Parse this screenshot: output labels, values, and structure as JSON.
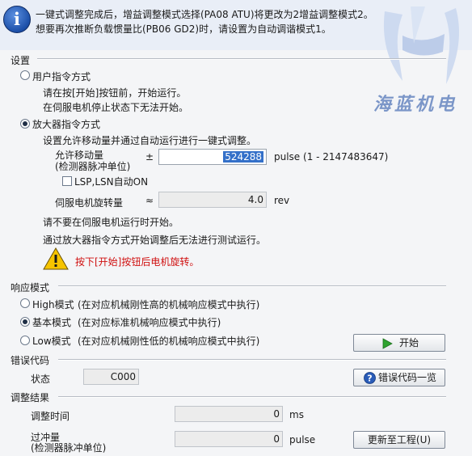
{
  "message": {
    "line1": "一键式调整完成后，增益调整模式选择(PA08 ATU)将更改为2增益调整模式2。",
    "line2": "想要再次推断负载惯量比(PB06 GD2)时，请设置为自动调谐模式1。"
  },
  "watermark": {
    "text": "海蓝机电"
  },
  "settings": {
    "title": "设置",
    "user_cmd": {
      "label": "用户指令方式",
      "checked": false,
      "desc1": "请在按[开始]按钮前，开始运行。",
      "desc2": "在伺服电机停止状态下无法开始。"
    },
    "amp_cmd": {
      "label": "放大器指令方式",
      "checked": true,
      "desc": "设置允许移动量并通过自动运行进行一键式调整。",
      "move_label1": "允许移动量",
      "move_label2": "(检测器脉冲单位)",
      "pm_sign": "±",
      "move_value": "524288",
      "move_unit": "pulse (1 - 2147483647)",
      "lsp_label": "LSP,LSN自动ON",
      "rot_label": "伺服电机旋转量",
      "approx_sign": "≈",
      "rot_value": "4.0",
      "rot_unit": "rev",
      "note1": "请不要在伺服电机运行时开始。",
      "note2": "通过放大器指令方式开始调整后无法进行测试运行。",
      "warning": "按下[开始]按钮后电机旋转。"
    }
  },
  "response": {
    "title": "响应模式",
    "modes": [
      {
        "label": "High模式",
        "desc": "(在对应机械刚性高的机械响应模式中执行)",
        "checked": false
      },
      {
        "label": "基本模式",
        "desc": "(在对应标准机械响应模式中执行)",
        "checked": true
      },
      {
        "label": "Low模式",
        "desc": "(在对应机械刚性低的机械响应模式中执行)",
        "checked": false
      }
    ],
    "start_button": "开始"
  },
  "error": {
    "title": "错误代码",
    "status_label": "状态",
    "status_value": "C000",
    "list_button": "错误代码一览"
  },
  "result": {
    "title": "调整结果",
    "time_label": "调整时间",
    "time_value": "0",
    "time_unit": "ms",
    "overshoot_label1": "过冲量",
    "overshoot_label2": "(检测器脉冲单位)",
    "overshoot_value": "0",
    "overshoot_unit": "pulse",
    "update_button": "更新至工程(U)"
  },
  "colors": {
    "accent": "#3470c9",
    "warning": "#d01010",
    "panel": "#f4f5f7"
  }
}
